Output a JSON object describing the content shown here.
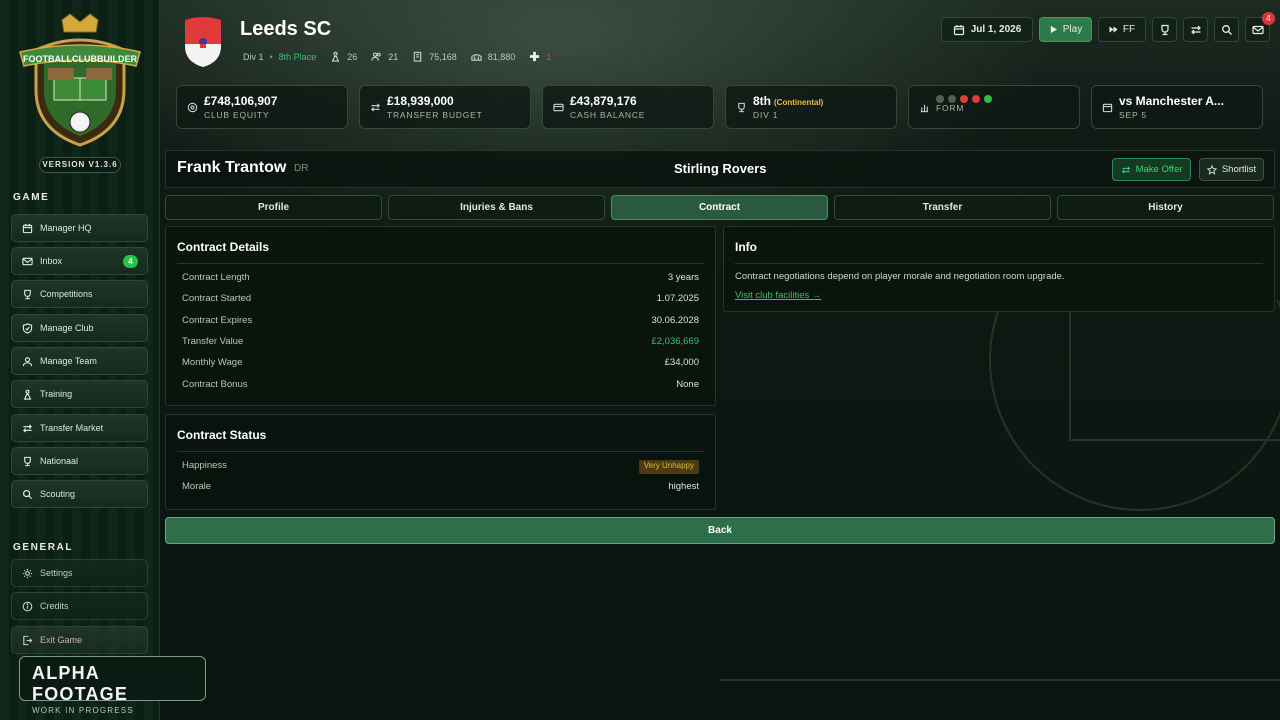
{
  "sidebar": {
    "version": "VERSION V1.3.6",
    "game_title": "GAME",
    "general_title": "GENERAL",
    "items": [
      {
        "label": "Manager HQ",
        "icon": "calendar-icon"
      },
      {
        "label": "Inbox",
        "icon": "mail-icon",
        "badge": "4"
      },
      {
        "label": "Competitions",
        "icon": "trophy-icon"
      },
      {
        "label": "Manage Club",
        "icon": "shield-icon"
      },
      {
        "label": "Manage Team",
        "icon": "team-icon"
      },
      {
        "label": "Training",
        "icon": "training-icon"
      },
      {
        "label": "Transfer Market",
        "icon": "transfer-icon"
      },
      {
        "label": "Nationaal",
        "icon": "trophy-icon"
      },
      {
        "label": "Scouting",
        "icon": "search-icon"
      }
    ],
    "general": [
      {
        "label": "Settings",
        "icon": "gear-icon"
      },
      {
        "label": "Credits",
        "icon": "info-icon"
      },
      {
        "label": "Exit Game",
        "icon": "exit-icon"
      }
    ],
    "alpha_title": "ALPHA FOOTAGE",
    "alpha_sub": "WORK IN PROGRESS"
  },
  "header": {
    "club": "Leeds SC",
    "division": "Div 1",
    "place": "8th Place",
    "players": "26",
    "staff": "21",
    "stadium": "75,168",
    "fans": "81,880",
    "medical": "1",
    "date": "Jul 1, 2026",
    "play": "Play",
    "ff": "FF",
    "mail_count": "4"
  },
  "cards": [
    {
      "value": "£748,106,907",
      "label": "CLUB EQUITY",
      "icon": "coin-icon"
    },
    {
      "value": "£18,939,000",
      "label": "TRANSFER BUDGET",
      "icon": "transfer-icon"
    },
    {
      "value": "£43,879,176",
      "label": "CASH BALANCE",
      "icon": "card-icon"
    },
    {
      "value": "8th",
      "sub": "(Continental)",
      "label": "DIV 1",
      "icon": "trophy-icon"
    },
    {
      "value": "",
      "label": "FORM",
      "icon": "bar-chart-icon",
      "form": [
        "#555f58",
        "#555f58",
        "#e03a3a",
        "#e03a3a",
        "#2bc24a"
      ]
    },
    {
      "value": "vs Manchester A...",
      "label": "SEP 5",
      "icon": "calendar-icon"
    }
  ],
  "player": {
    "name": "Frank Trantow",
    "position": "DR",
    "club": "Stirling Rovers",
    "make_offer": "Make Offer",
    "shortlist": "Shortlist"
  },
  "tabs": [
    "Profile",
    "Injuries & Bans",
    "Contract",
    "Transfer",
    "History"
  ],
  "contract_details": {
    "title": "Contract Details",
    "rows": [
      {
        "k": "Contract Length",
        "v": "3 years"
      },
      {
        "k": "Contract Started",
        "v": "1.07.2025"
      },
      {
        "k": "Contract Expires",
        "v": "30.06.2028"
      },
      {
        "k": "Transfer Value",
        "v": "£2,036,669"
      },
      {
        "k": "Monthly Wage",
        "v": "£34,000"
      },
      {
        "k": "Contract Bonus",
        "v": "None"
      }
    ]
  },
  "contract_status": {
    "title": "Contract Status",
    "rows": [
      {
        "k": "Happiness",
        "v": "Very Unhappy"
      },
      {
        "k": "Morale",
        "v": "highest"
      }
    ]
  },
  "info": {
    "title": "Info",
    "text": "Contract negotiations depend on player morale and negotiation room upgrade.",
    "link": "Visit club facilities →"
  },
  "back": "Back"
}
